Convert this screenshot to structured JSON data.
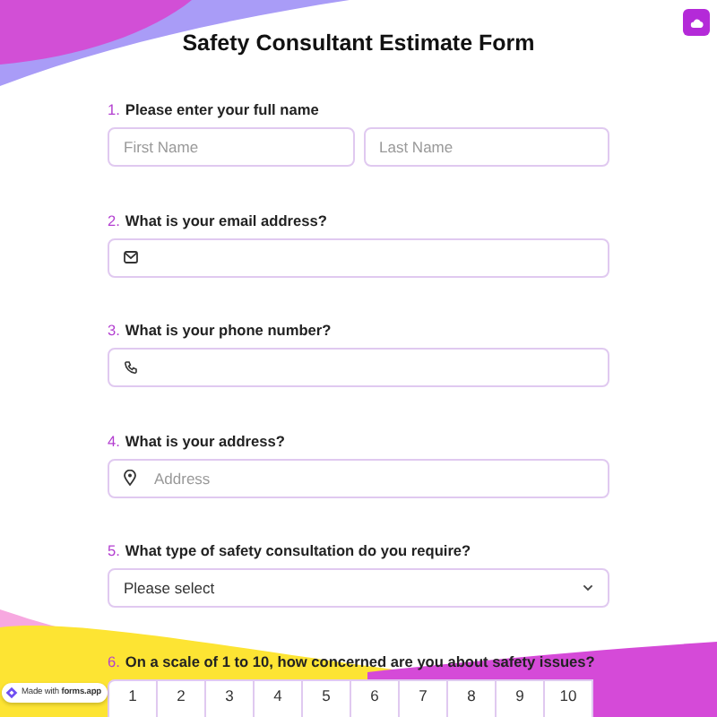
{
  "title": "Safety Consultant Estimate Form",
  "questions": [
    {
      "number": "1.",
      "label": "Please enter your full name",
      "kind": "name",
      "fields": [
        {
          "placeholder": "First Name"
        },
        {
          "placeholder": "Last Name"
        }
      ]
    },
    {
      "number": "2.",
      "label": "What is your email address?",
      "kind": "email"
    },
    {
      "number": "3.",
      "label": "What is your phone number?",
      "kind": "phone"
    },
    {
      "number": "4.",
      "label": "What is your address?",
      "kind": "address",
      "placeholder": "Address"
    },
    {
      "number": "5.",
      "label": "What type of safety consultation do you require?",
      "kind": "select",
      "value": "Please select"
    },
    {
      "number": "6.",
      "label": "On a scale of 1 to 10, how concerned are you about safety issues?",
      "kind": "scale",
      "options": [
        "1",
        "2",
        "3",
        "4",
        "5",
        "6",
        "7",
        "8",
        "9",
        "10"
      ]
    }
  ],
  "badge": "Made with **forms.app**"
}
